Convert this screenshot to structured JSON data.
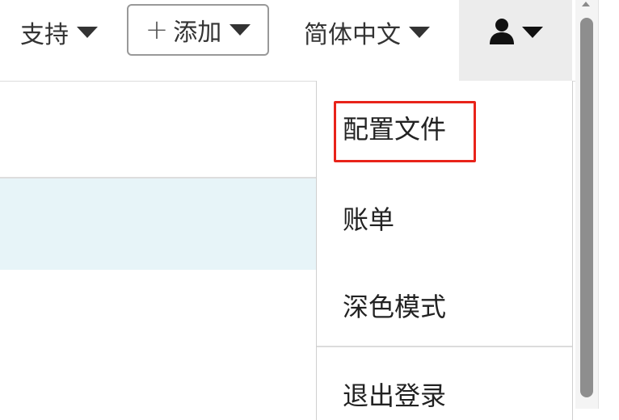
{
  "nav": {
    "support_label": "支持",
    "add_label": "添加",
    "add_icon": "plus-icon",
    "language_label": "简体中文",
    "user_icon": "user-icon",
    "caret_icon": "caret-down-icon"
  },
  "dropdown": {
    "items": [
      {
        "label": "配置文件",
        "highlighted": true
      },
      {
        "label": "账单"
      },
      {
        "label": "深色模式"
      },
      {
        "label": "退出登录"
      }
    ]
  },
  "colors": {
    "highlight_border": "#e8231a",
    "selected_row_bg": "#e7f4f8",
    "user_button_bg": "#ececec",
    "scrollbar_thumb": "#8e8e8e"
  }
}
